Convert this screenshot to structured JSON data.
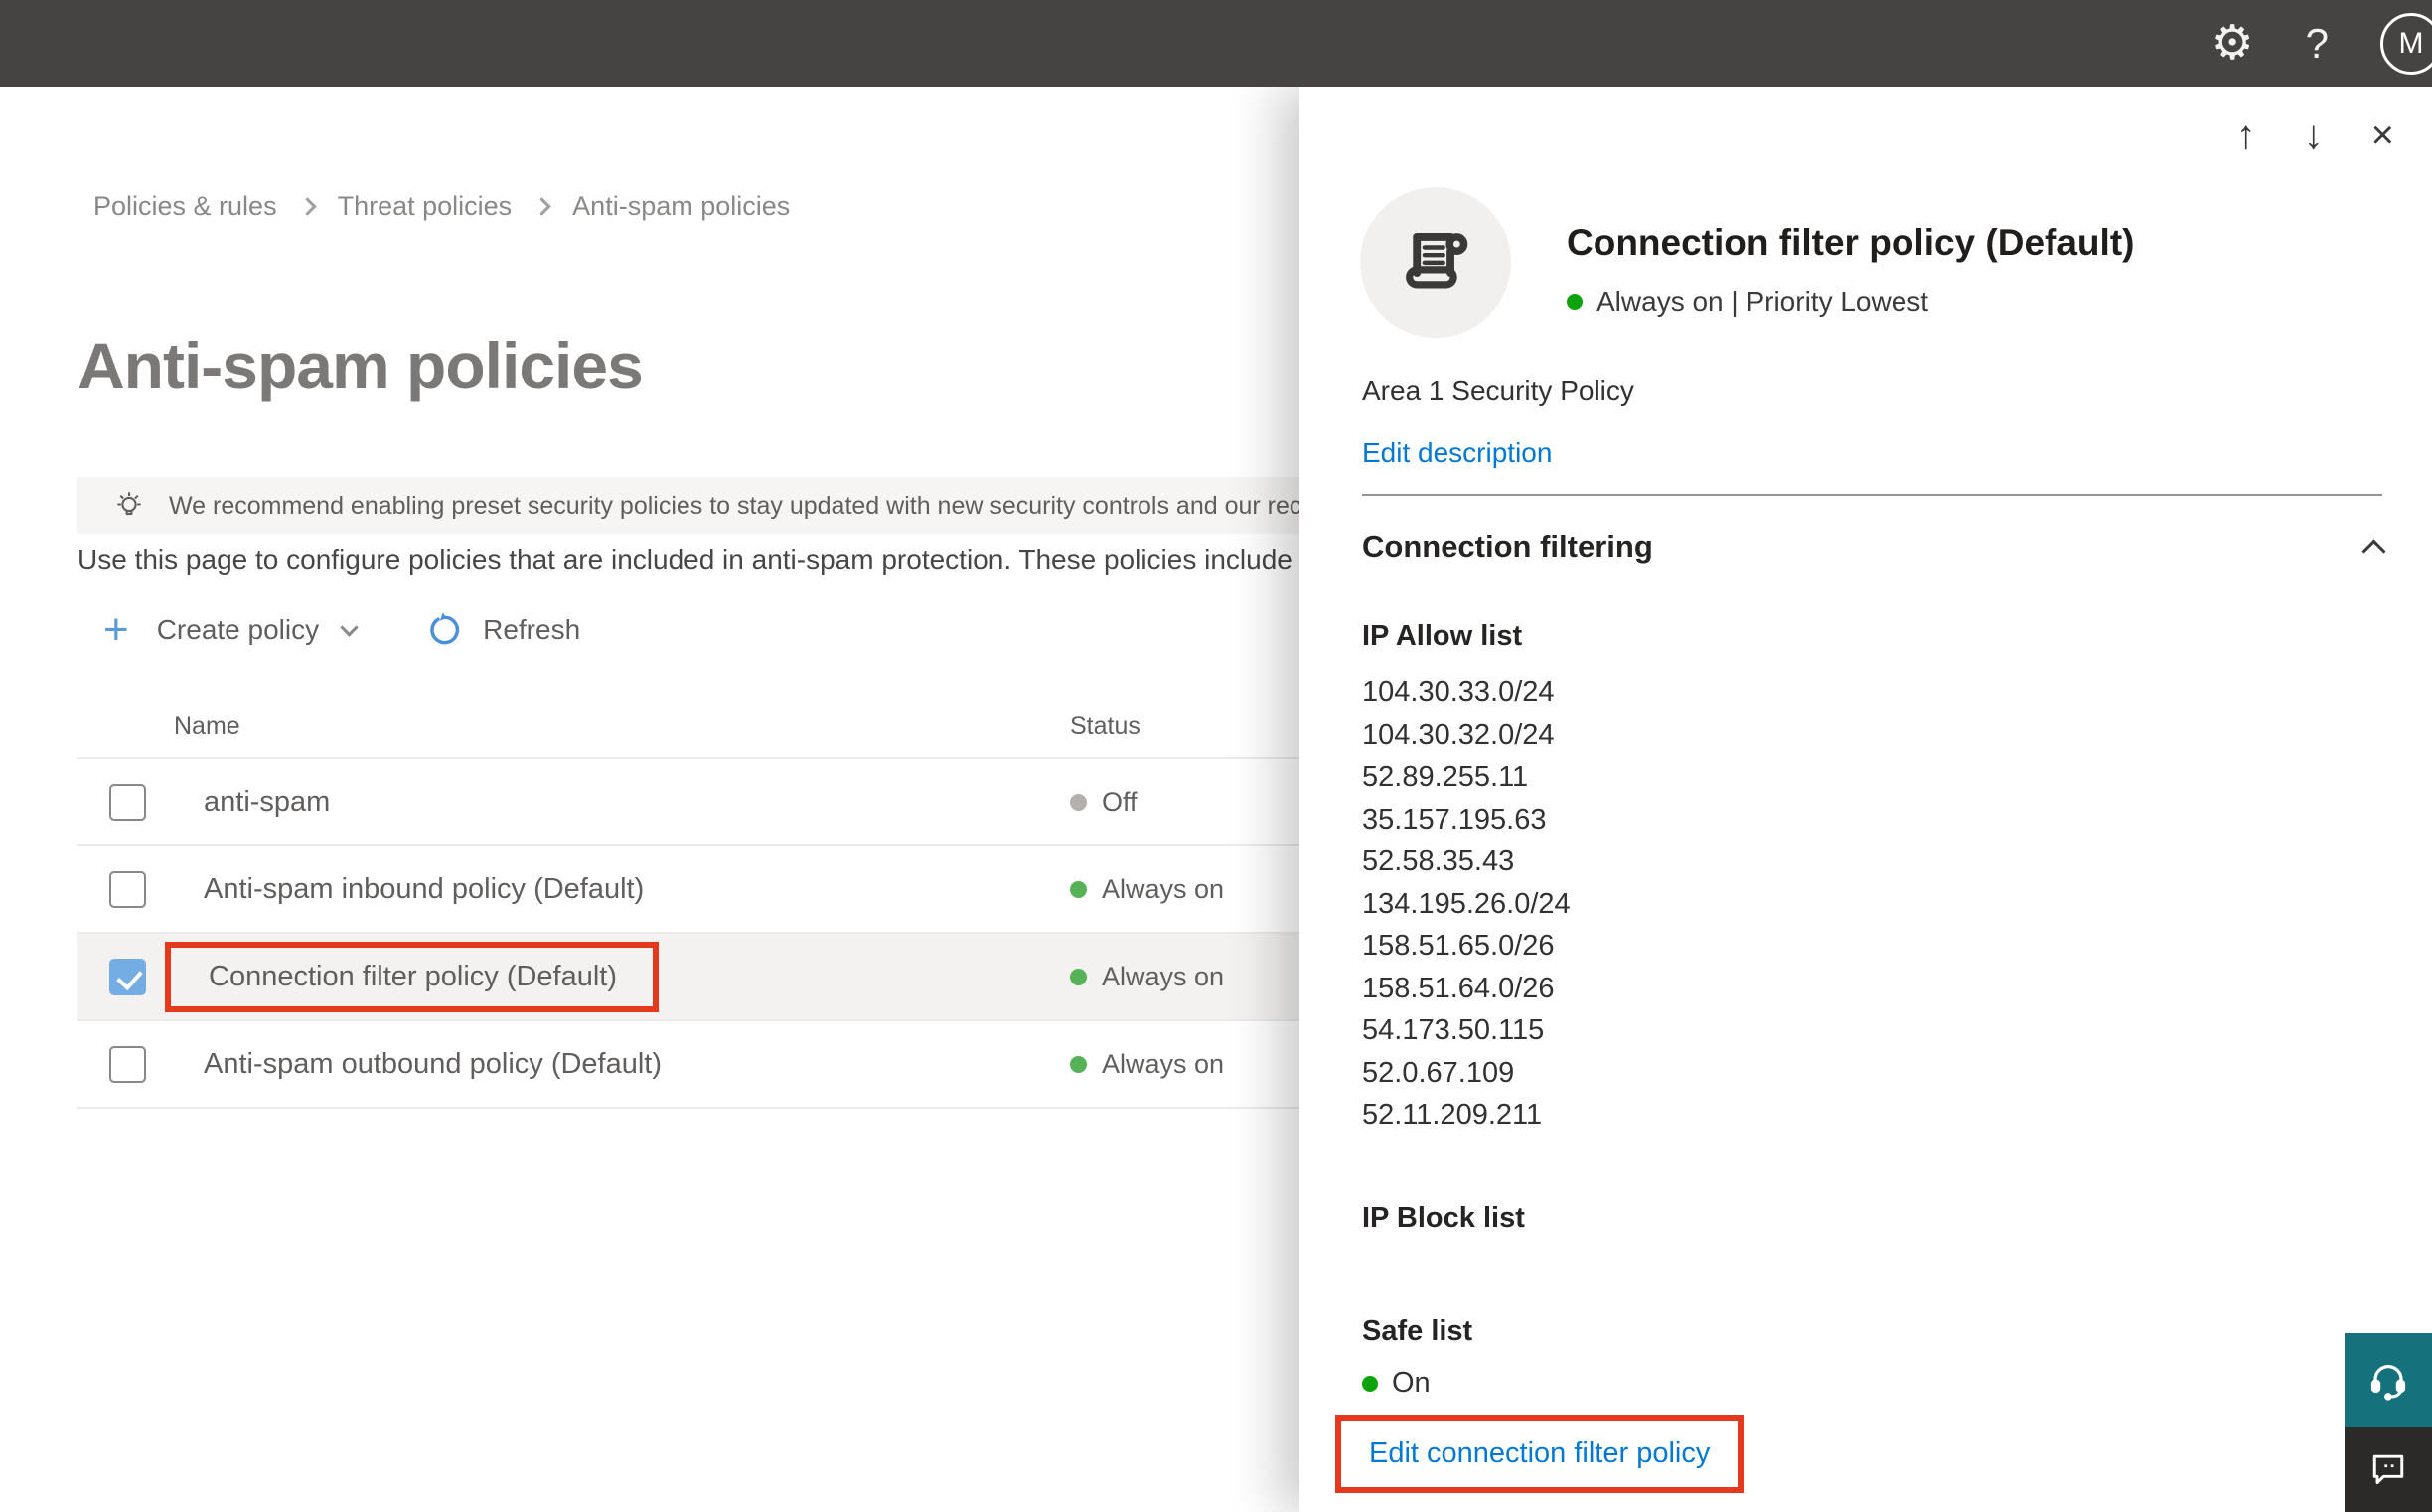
{
  "topbar": {
    "help_label": "?",
    "avatar_initial": "M"
  },
  "breadcrumb": {
    "items": [
      "Policies & rules",
      "Threat policies",
      "Anti-spam policies"
    ]
  },
  "page": {
    "title": "Anti-spam policies",
    "banner_text": "We recommend enabling preset security policies to stay updated with new security controls and our recomme",
    "intro_text": "Use this page to configure policies that are included in anti-spam protection. These policies include ",
    "toolbar": {
      "create_label": "Create policy",
      "refresh_label": "Refresh"
    }
  },
  "table": {
    "columns": {
      "name": "Name",
      "status": "Status"
    },
    "rows": [
      {
        "name": "anti-spam",
        "status": "Off",
        "checked": false,
        "selected": false
      },
      {
        "name": "Anti-spam inbound policy (Default)",
        "status": "Always on",
        "checked": false,
        "selected": false
      },
      {
        "name": "Connection filter policy (Default)",
        "status": "Always on",
        "checked": true,
        "selected": true
      },
      {
        "name": "Anti-spam outbound policy (Default)",
        "status": "Always on",
        "checked": false,
        "selected": false
      }
    ]
  },
  "panel": {
    "title": "Connection filter policy (Default)",
    "status_line": "Always on | Priority Lowest",
    "description": "Area 1 Security Policy",
    "edit_description_label": "Edit description",
    "section_title": "Connection filtering",
    "ip_allow": {
      "label": "IP Allow list",
      "items": [
        "104.30.33.0/24",
        "104.30.32.0/24",
        "52.89.255.11",
        "35.157.195.63",
        "52.58.35.43",
        "134.195.26.0/24",
        "158.51.65.0/26",
        "158.51.64.0/26",
        "54.173.50.115",
        "52.0.67.109",
        "52.11.209.211"
      ]
    },
    "ip_block": {
      "label": "IP Block list"
    },
    "safe_list": {
      "label": "Safe list",
      "status": "On"
    },
    "edit_policy_label": "Edit connection filter policy"
  },
  "colors": {
    "accent_blue": "#0078d4",
    "annotation_red": "#e4391c",
    "status_green": "#57b257",
    "status_gray": "#b3b0ad",
    "topbar_bg": "#454442",
    "support_teal": "#15717b"
  }
}
